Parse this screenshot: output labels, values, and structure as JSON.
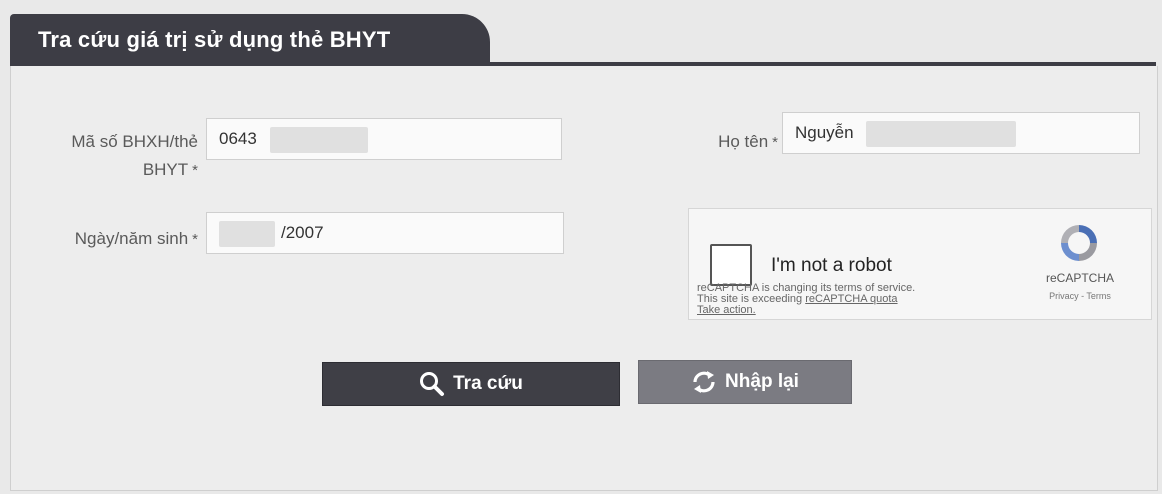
{
  "header": {
    "title": "Tra cứu giá trị sử dụng thẻ BHYT"
  },
  "form": {
    "insurance_number": {
      "label_line1": "Mã số BHXH/thẻ",
      "label_line2": "BHYT",
      "required_mark": "*",
      "value": "0643"
    },
    "full_name": {
      "label": "Họ tên",
      "required_mark": "*",
      "value": "Nguyễn"
    },
    "birth_date": {
      "label": "Ngày/năm sinh",
      "required_mark": "*",
      "value": "/2007"
    }
  },
  "captcha": {
    "checkbox_label": "I'm not a robot",
    "notice_line1": "reCAPTCHA is changing its terms of service.",
    "notice_line2_prefix": "This site is exceeding ",
    "notice_line2_link": "reCAPTCHA quota",
    "notice_line3": "Take action.",
    "brand": "reCAPTCHA",
    "links": "Privacy - Terms"
  },
  "buttons": {
    "search_label": "Tra cứu",
    "reset_label": "Nhập lại"
  },
  "colors": {
    "header_bg": "#3d3d45",
    "search_button": "#3f3f46",
    "reset_button": "#7b7b82",
    "panel_bg": "#ededed"
  },
  "icons": {
    "search": "magnifier-icon",
    "reset": "refresh-icon",
    "recaptcha": "recaptcha-logo-icon"
  }
}
